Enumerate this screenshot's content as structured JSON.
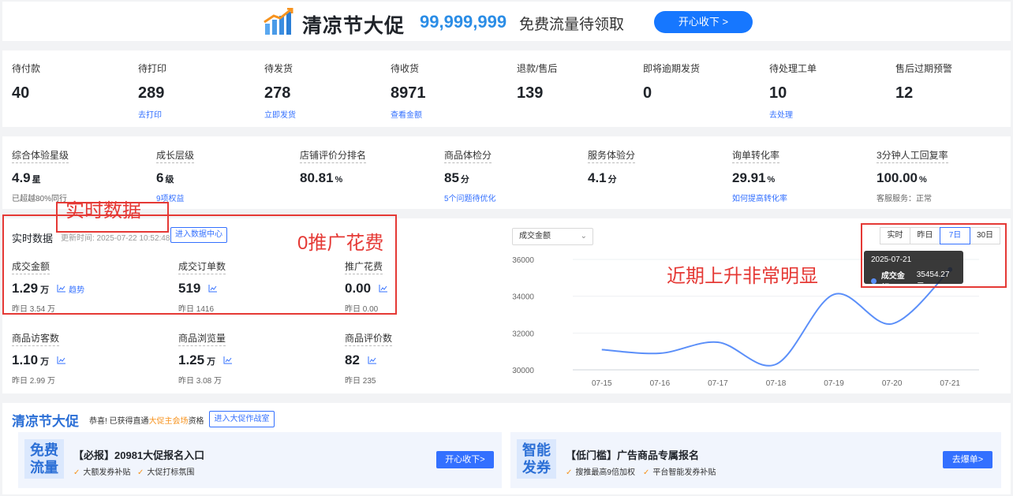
{
  "banner": {
    "title": "清凉节大促",
    "amount": "99,999,999",
    "text": "免费流量待领取",
    "button": "开心收下 >"
  },
  "orders": [
    {
      "label": "待付款",
      "value": "40",
      "link": ""
    },
    {
      "label": "待打印",
      "value": "289",
      "link": "去打印"
    },
    {
      "label": "待发货",
      "value": "278",
      "link": "立即发货"
    },
    {
      "label": "待收货",
      "value": "8971",
      "link": "查看金额"
    },
    {
      "label": "退款/售后",
      "value": "139",
      "link": ""
    },
    {
      "label": "即将逾期发货",
      "value": "0",
      "link": ""
    },
    {
      "label": "待处理工单",
      "value": "10",
      "link": "去处理"
    },
    {
      "label": "售后过期预警",
      "value": "12",
      "link": ""
    }
  ],
  "metrics": [
    {
      "label": "综合体验星级",
      "value": "4.9",
      "unit": "星",
      "sub": "已超越80%同行"
    },
    {
      "label": "成长层级",
      "value": "6",
      "unit": "级",
      "sub": "9项权益"
    },
    {
      "label": "店铺评价分排名",
      "value": "80.81",
      "unit": "%",
      "sub": ""
    },
    {
      "label": "商品体检分",
      "value": "85",
      "unit": "分",
      "sub": "5个问题待优化"
    },
    {
      "label": "服务体验分",
      "value": "4.1",
      "unit": "分",
      "sub": ""
    },
    {
      "label": "询单转化率",
      "value": "29.91",
      "unit": "%",
      "sub": "如何提高转化率"
    },
    {
      "label": "3分钟人工回复率",
      "value": "100.00",
      "unit": "%",
      "sub": "客服服务：正常"
    }
  ],
  "realtime": {
    "title": "实时数据",
    "update_time": "更新时间: 2025-07-22 10:52:48",
    "button": "进入数据中心",
    "trend_label": "趋势",
    "stats": [
      {
        "label": "成交金额",
        "value": "1.29",
        "unit": "万",
        "sub": "昨日 3.54 万"
      },
      {
        "label": "成交订单数",
        "value": "519",
        "unit": "",
        "sub": "昨日 1416"
      },
      {
        "label": "推广花费",
        "value": "0.00",
        "unit": "",
        "sub": "昨日 0.00"
      },
      {
        "label": "商品访客数",
        "value": "1.10",
        "unit": "万",
        "sub": "昨日 2.99 万"
      },
      {
        "label": "商品浏览量",
        "value": "1.25",
        "unit": "万",
        "sub": "昨日 3.08 万"
      },
      {
        "label": "商品评价数",
        "value": "82",
        "unit": "",
        "sub": "昨日 235"
      }
    ]
  },
  "annotations": {
    "realtime": "实时数据",
    "promo_cost": "0推广花费",
    "trend": "近期上升非常明显"
  },
  "chart_controls": {
    "metric_select": "成交金额",
    "tabs": [
      "实时",
      "昨日",
      "7日",
      "30日"
    ],
    "active_tab": "7日"
  },
  "chart_data": {
    "type": "line",
    "x": [
      "07-15",
      "07-16",
      "07-17",
      "07-18",
      "07-19",
      "07-20",
      "07-21"
    ],
    "series": [
      {
        "name": "成交金额",
        "values": [
          31100,
          30900,
          31500,
          30300,
          34100,
          32500,
          35454.27
        ]
      }
    ],
    "ylim": [
      30000,
      36000
    ],
    "yticks": [
      30000,
      32000,
      34000,
      36000
    ],
    "grid": true,
    "line_color": "#5b8ff9",
    "tooltip": {
      "date": "2025-07-21",
      "label": "成交金额",
      "value": "35454.27元"
    }
  },
  "promo": {
    "title": "清凉节大促",
    "text_before": "恭喜! 已获得直通",
    "text_highlight": "大促主会场",
    "text_after": "资格",
    "button": "进入大促作战室",
    "cards": [
      {
        "badge": [
          "免费",
          "流量"
        ],
        "title": "【必报】20981大促报名入口",
        "features": [
          "大额发券补贴",
          "大促打标氛围"
        ],
        "button": "开心收下>"
      },
      {
        "badge": [
          "智能",
          "发券"
        ],
        "title": "【低门槛】广告商品专属报名",
        "features": [
          "搜推最高9倍加权",
          "平台智能发券补贴"
        ],
        "button": "去爆单>"
      }
    ]
  },
  "colors": {
    "accent": "#3370ff",
    "annotation": "#e53935",
    "highlight": "#f7931e",
    "line": "#5b8ff9"
  }
}
